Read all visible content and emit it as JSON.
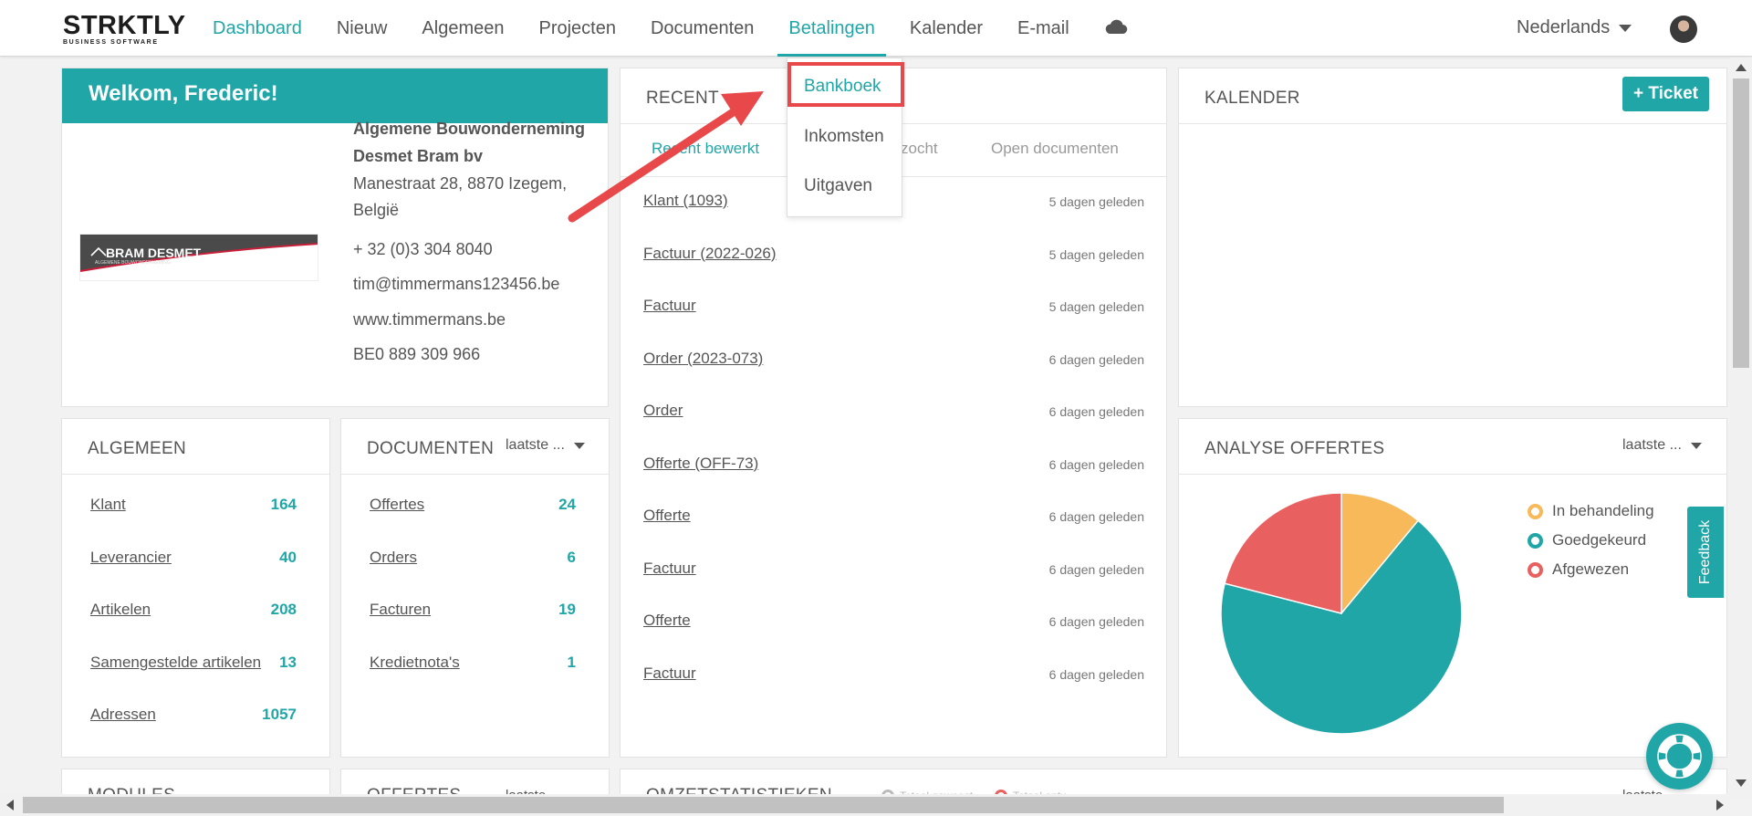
{
  "app": {
    "logo_main": "STRKTLY",
    "logo_sub": "BUSINESS SOFTWARE"
  },
  "nav": {
    "items": [
      "Dashboard",
      "Nieuw",
      "Algemeen",
      "Projecten",
      "Documenten",
      "Betalingen",
      "Kalender",
      "E-mail"
    ],
    "active": "Dashboard",
    "open_menu": "Betalingen",
    "language": "Nederlands"
  },
  "payments_menu": {
    "items": [
      "Bankboek",
      "Inkomsten",
      "Uitgaven"
    ],
    "highlighted": "Bankboek"
  },
  "welcome": {
    "title": "Welkom, Frederic!",
    "logo_text": "BRAM DESMET",
    "logo_tagline": "ALGEMENE BOUWONDERNEMING",
    "company_line1": "Algemene Bouwonderneming",
    "company_line2": "Desmet Bram bv",
    "address_line1": "Manestraat 28, 8870 Izegem,",
    "address_line2": "België",
    "phone": "+ 32 (0)3 304 8040",
    "email": "tim@timmermans123456.be",
    "website": "www.timmermans.be",
    "vat": "BE0 889 309 966"
  },
  "recent": {
    "title": "RECENT",
    "tabs": [
      "Recent bewerkt",
      "zocht",
      "Open documenten"
    ],
    "rows": [
      {
        "label": "Klant (1093)",
        "time": "5 dagen geleden"
      },
      {
        "label": "Factuur (2022-026)",
        "time": "5 dagen geleden"
      },
      {
        "label": "Factuur",
        "time": "5 dagen geleden"
      },
      {
        "label": "Order (2023-073)",
        "time": "6 dagen geleden"
      },
      {
        "label": "Order",
        "time": "6 dagen geleden"
      },
      {
        "label": "Offerte (OFF-73)",
        "time": "6 dagen geleden"
      },
      {
        "label": "Offerte",
        "time": "6 dagen geleden"
      },
      {
        "label": "Factuur",
        "time": "6 dagen geleden"
      },
      {
        "label": "Offerte",
        "time": "6 dagen geleden"
      },
      {
        "label": "Factuur",
        "time": "6 dagen geleden"
      }
    ]
  },
  "calendar": {
    "title": "KALENDER",
    "ticket_button": "+ Ticket"
  },
  "algemeen": {
    "title": "ALGEMEEN",
    "rows": [
      {
        "label": "Klant",
        "count": "164"
      },
      {
        "label": "Leverancier",
        "count": "40"
      },
      {
        "label": "Artikelen",
        "count": "208"
      },
      {
        "label": "Samengestelde artikelen",
        "count": "13"
      },
      {
        "label": "Adressen",
        "count": "1057"
      }
    ]
  },
  "documenten": {
    "title": "DOCUMENTEN",
    "filter": "laatste ...",
    "rows": [
      {
        "label": "Offertes",
        "count": "24"
      },
      {
        "label": "Orders",
        "count": "6"
      },
      {
        "label": "Facturen",
        "count": "19"
      },
      {
        "label": "Kredietnota's",
        "count": "1"
      }
    ]
  },
  "analyse": {
    "title": "ANALYSE OFFERTES",
    "filter": "laatste ..."
  },
  "chart_data": {
    "type": "pie",
    "categories": [
      "In behandeling",
      "Goedgekeurd",
      "Afgewezen"
    ],
    "values": [
      11,
      68,
      21
    ],
    "colors": [
      "#f8b95b",
      "#21a6a8",
      "#e86060"
    ]
  },
  "bottom": {
    "modules": "MODULES",
    "offertes": "OFFERTES",
    "offertes_filter": "laatste",
    "omzet": "OMZETSTATISTIEKEN",
    "omzet_legend1": "Totaal geweest",
    "omzet_legend2": "Totaal ontv",
    "omzet_filter": "laatste"
  },
  "widgets": {
    "feedback": "Feedback"
  },
  "colors": {
    "accent": "#21a6a8",
    "highlight": "#e8484a"
  }
}
